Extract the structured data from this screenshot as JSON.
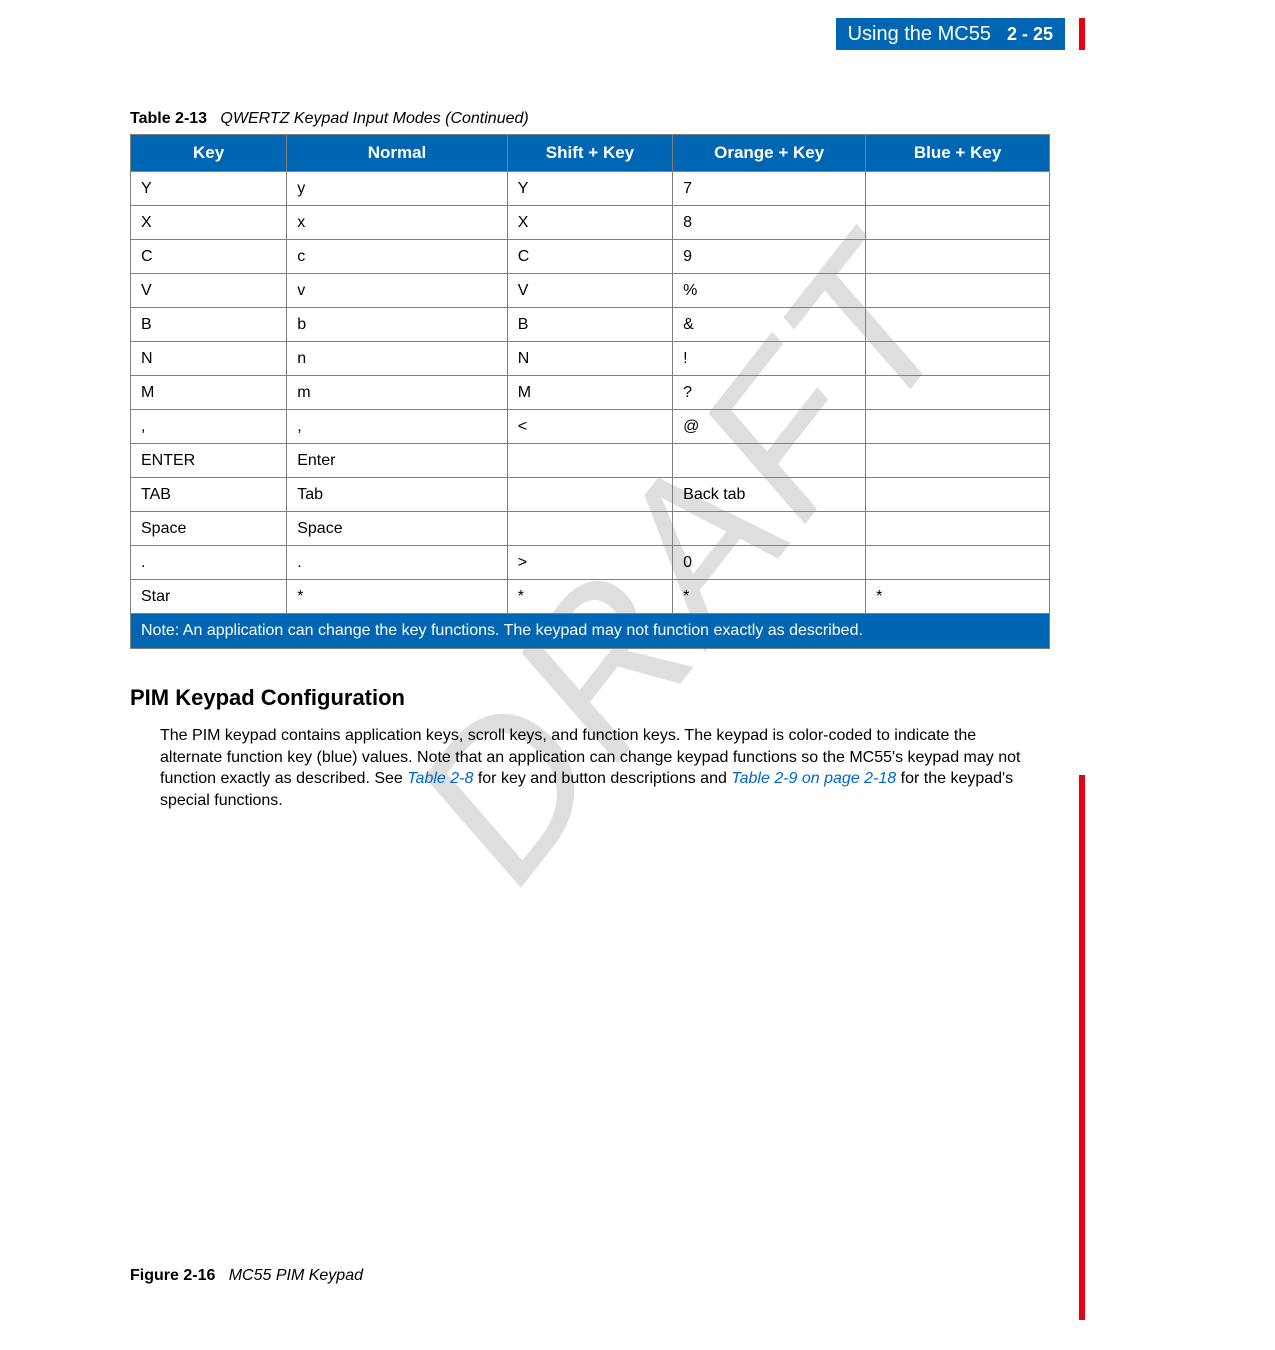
{
  "header": {
    "title": "Using the MC55",
    "pagenum": "2 - 25"
  },
  "watermark": "DRAFT",
  "table": {
    "caption_label": "Table 2-13",
    "caption_title": "QWERTZ Keypad Input Modes (Continued)",
    "headers": [
      "Key",
      "Normal",
      "Shift + Key",
      "Orange + Key",
      "Blue + Key"
    ],
    "rows": [
      [
        "Y",
        "y",
        "Y",
        "7",
        ""
      ],
      [
        "X",
        "x",
        "X",
        "8",
        ""
      ],
      [
        "C",
        "c",
        "C",
        "9",
        ""
      ],
      [
        "V",
        "v",
        "V",
        "%",
        ""
      ],
      [
        "B",
        "b",
        "B",
        "&",
        ""
      ],
      [
        "N",
        "n",
        "N",
        "!",
        ""
      ],
      [
        "M",
        "m",
        "M",
        "?",
        ""
      ],
      [
        ",",
        ",",
        "<",
        "@",
        ""
      ],
      [
        "ENTER",
        "Enter",
        "",
        "",
        ""
      ],
      [
        "TAB",
        "Tab",
        "",
        "Back tab",
        ""
      ],
      [
        "Space",
        "Space",
        "",
        "",
        ""
      ],
      [
        ".",
        ".",
        ">",
        "0",
        ""
      ],
      [
        "Star",
        "*",
        "*",
        "*",
        "*"
      ]
    ],
    "note": "Note: An application can change the key functions. The keypad may not function exactly as described."
  },
  "section": {
    "heading": "PIM Keypad Configuration",
    "para_pre": "The PIM keypad contains application keys, scroll keys, and function keys. The keypad is color-coded to indicate the alternate function key (blue) values. Note that an application can change keypad functions so the MC55's keypad may not function exactly as described. See ",
    "link1": "Table 2-8",
    "para_mid": " for key and button descriptions and ",
    "link2": "Table 2-9 on page 2-18",
    "para_post": " for the keypad's special functions."
  },
  "figure": {
    "label": "Figure 2-16",
    "title": "MC55 PIM Keypad"
  }
}
